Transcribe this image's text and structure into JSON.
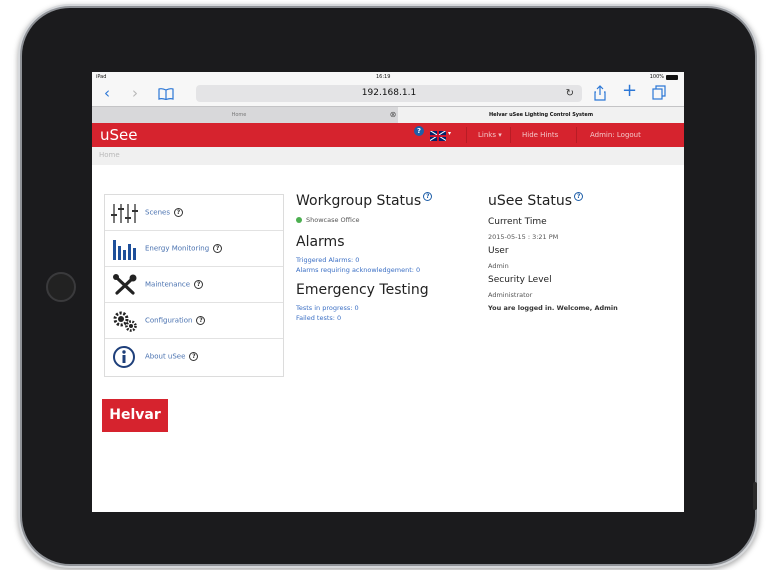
{
  "statusbar": {
    "carrier": "iPad",
    "time": "16:19",
    "battery": "100%"
  },
  "browser": {
    "url": "192.168.1.1",
    "tab1_title": "Home",
    "tab2_title": "Helvar uSee Lighting Control System"
  },
  "app": {
    "logo": "uSee",
    "nav": {
      "links": "Links",
      "hide_hints": "Hide Hints",
      "admin_logout": "Admin: Logout"
    },
    "breadcrumb": "Home",
    "brand": "Helvar"
  },
  "menu": {
    "items": [
      {
        "label": "Scenes",
        "icon": "sliders-icon"
      },
      {
        "label": "Energy Monitoring",
        "icon": "bar-chart-icon"
      },
      {
        "label": "Maintenance",
        "icon": "tools-icon"
      },
      {
        "label": "Configuration",
        "icon": "gears-icon"
      },
      {
        "label": "About uSee",
        "icon": "info-icon"
      }
    ]
  },
  "workgroup": {
    "title": "Workgroup Status",
    "item": "Showcase Office"
  },
  "alarms": {
    "title": "Alarms",
    "triggered": "Triggered Alarms: 0",
    "requiring_ack": "Alarms requiring acknowledgement: 0"
  },
  "emergency": {
    "title": "Emergency Testing",
    "in_progress": "Tests in progress: 0",
    "failed": "Failed tests: 0"
  },
  "usee_status": {
    "title": "uSee Status",
    "current_time_label": "Current Time",
    "current_time_value": "2015-05-15 : 3:21 PM",
    "user_label": "User",
    "user_value": "Admin",
    "security_label": "Security Level",
    "security_value": "Administrator",
    "welcome": "You are logged in. Welcome, Admin"
  },
  "colors": {
    "brand_red": "#d6232e",
    "link_blue": "#3b6fc4",
    "ios_blue": "#2c77d6"
  }
}
